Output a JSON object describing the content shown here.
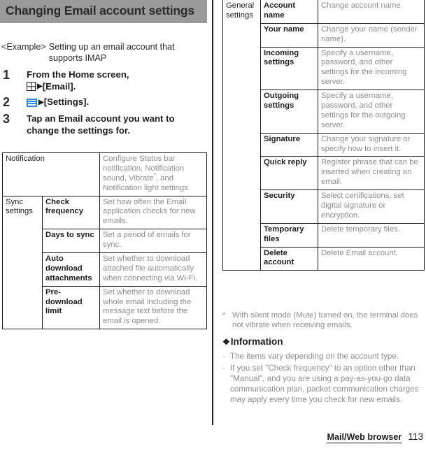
{
  "header": {
    "title": "Changing Email account settings",
    "background_color": "#9a9a9a"
  },
  "example": {
    "label": "<Example>",
    "text": "Setting up an email account that supports IMAP"
  },
  "steps": [
    {
      "number": "1",
      "line1": "From the Home screen,",
      "icon": "app-drawer-grid-icon",
      "arrow": "▶",
      "target": "[Email]."
    },
    {
      "number": "2",
      "icon": "menu-icon",
      "icon_color": "#2e8ae6",
      "arrow": "▶",
      "target": "[Settings]."
    },
    {
      "number": "3",
      "line1": "Tap an Email account you want to change the settings for."
    }
  ],
  "table_left": {
    "rows": [
      {
        "group": "Notification",
        "group_span": 2,
        "item": "",
        "desc": "Configure Status bar notification, Notification sound, Vibrate*, and Notification light settings.",
        "desc_pre": "Configure Status bar notification, Notification sound, Vibrate",
        "desc_post": ", and Notification light settings."
      },
      {
        "group": "Sync settings",
        "item": "Check frequency",
        "desc": "Set how often the Email application checks for new emails."
      },
      {
        "item": "Days to sync",
        "desc": "Set a period of emails for sync."
      },
      {
        "item": "Auto download attachments",
        "desc": "Set whether to download attached file automatically when connecting via Wi-Fi."
      },
      {
        "item": "Pre-download limit",
        "desc": "Set whether to download whole email including the message text before the email is opened."
      }
    ]
  },
  "table_right": {
    "rows": [
      {
        "group": "General settings",
        "item": "Account name",
        "desc": "Change account name."
      },
      {
        "item": "Your name",
        "desc": "Change your name (sender name)."
      },
      {
        "item": "Incoming settings",
        "desc": "Specify a username, password, and other settings for the incoming server."
      },
      {
        "item": "Outgoing settings",
        "desc": "Specify a username, password, and other settings for the outgoing server."
      },
      {
        "item": "Signature",
        "desc": "Change your signature or specify how to insert it."
      },
      {
        "item": "Quick reply",
        "desc": "Register phrase that can be inserted when creating an email."
      },
      {
        "item": "Security",
        "desc": "Select certifications, set digital signature or encryption."
      },
      {
        "item": "Temporary files",
        "desc": "Delete temporary files."
      },
      {
        "item": "Delete account",
        "desc": "Delete Email account."
      }
    ]
  },
  "footnote": {
    "mark": "*",
    "text": "With silent mode (Mute) turned on, the terminal does not vibrate when receiving emails."
  },
  "information": {
    "diamond": "❖",
    "heading": "Information",
    "items": [
      "The items vary depending on the account type.",
      "If you set \"Check frequency\" to an option other than \"Manual\", and you are using a pay-as-you-go data communication plan, packet communication charges may apply every time you check for new emails."
    ],
    "bullet": "·"
  },
  "footer": {
    "section": "Mail/Web browser",
    "page_number": "113"
  }
}
